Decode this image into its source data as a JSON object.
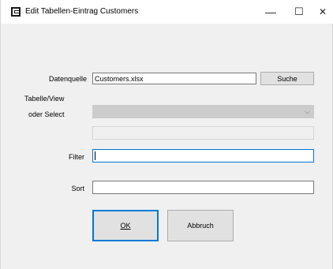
{
  "window": {
    "title": "Edit Tabellen-Eintrag Customers",
    "minimize_glyph": "—",
    "maximize_glyph": "☐",
    "close_glyph": "✕",
    "icon": "app-icon"
  },
  "form": {
    "datenquelle_label": "Datenquelle",
    "datenquelle_value": "Customers.xlsx",
    "suche_label": "Suche",
    "tabelle_label_line1": "Tabelle/View",
    "tabelle_label_line2": "oder Select",
    "tabelle_value": "",
    "select_value": "",
    "filter_label": "Filter",
    "filter_value": "",
    "sort_label": "Sort",
    "sort_value": ""
  },
  "buttons": {
    "ok_label": "OK",
    "abbruch_label": "Abbruch"
  }
}
